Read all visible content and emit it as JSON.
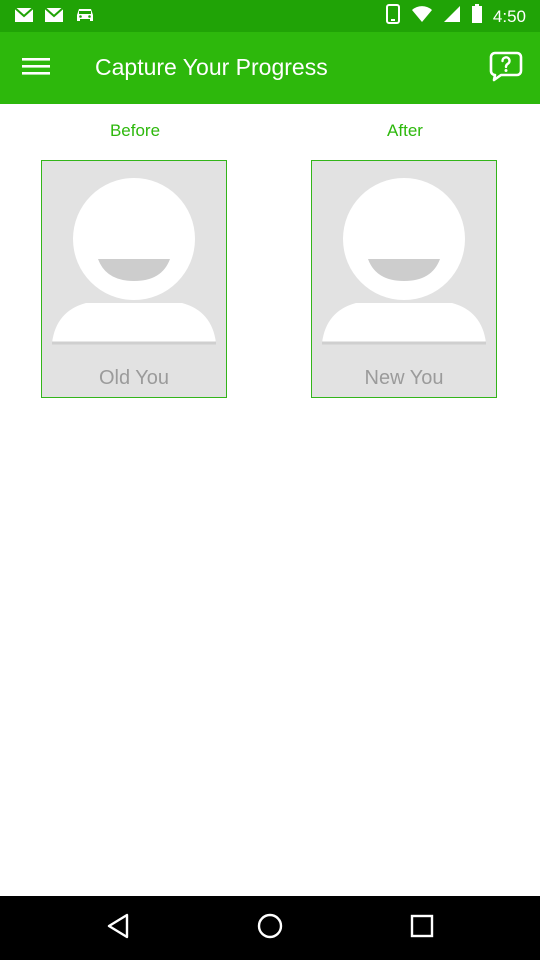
{
  "status_bar": {
    "time": "4:50",
    "icons": [
      "mail-icon",
      "mail-icon",
      "car-icon",
      "phone-icon",
      "wifi-icon",
      "cellular-signal-icon",
      "battery-icon"
    ]
  },
  "app_bar": {
    "title": "Capture Your Progress",
    "menu_icon": "hamburger-menu-icon",
    "help_icon": "help-chat-icon"
  },
  "columns": {
    "before": {
      "label": "Before",
      "caption": "Old You"
    },
    "after": {
      "label": "After",
      "caption": "New You"
    }
  },
  "nav_bar": {
    "icons": [
      "back-triangle-icon",
      "home-circle-icon",
      "recents-square-icon"
    ]
  },
  "colors": {
    "status_bar": "#20a306",
    "app_bar": "#2db80c",
    "accent": "#2db80c",
    "card_border": "#33b51a",
    "placeholder_bg": "#e2e2e2",
    "caption": "#9b9b9b"
  }
}
